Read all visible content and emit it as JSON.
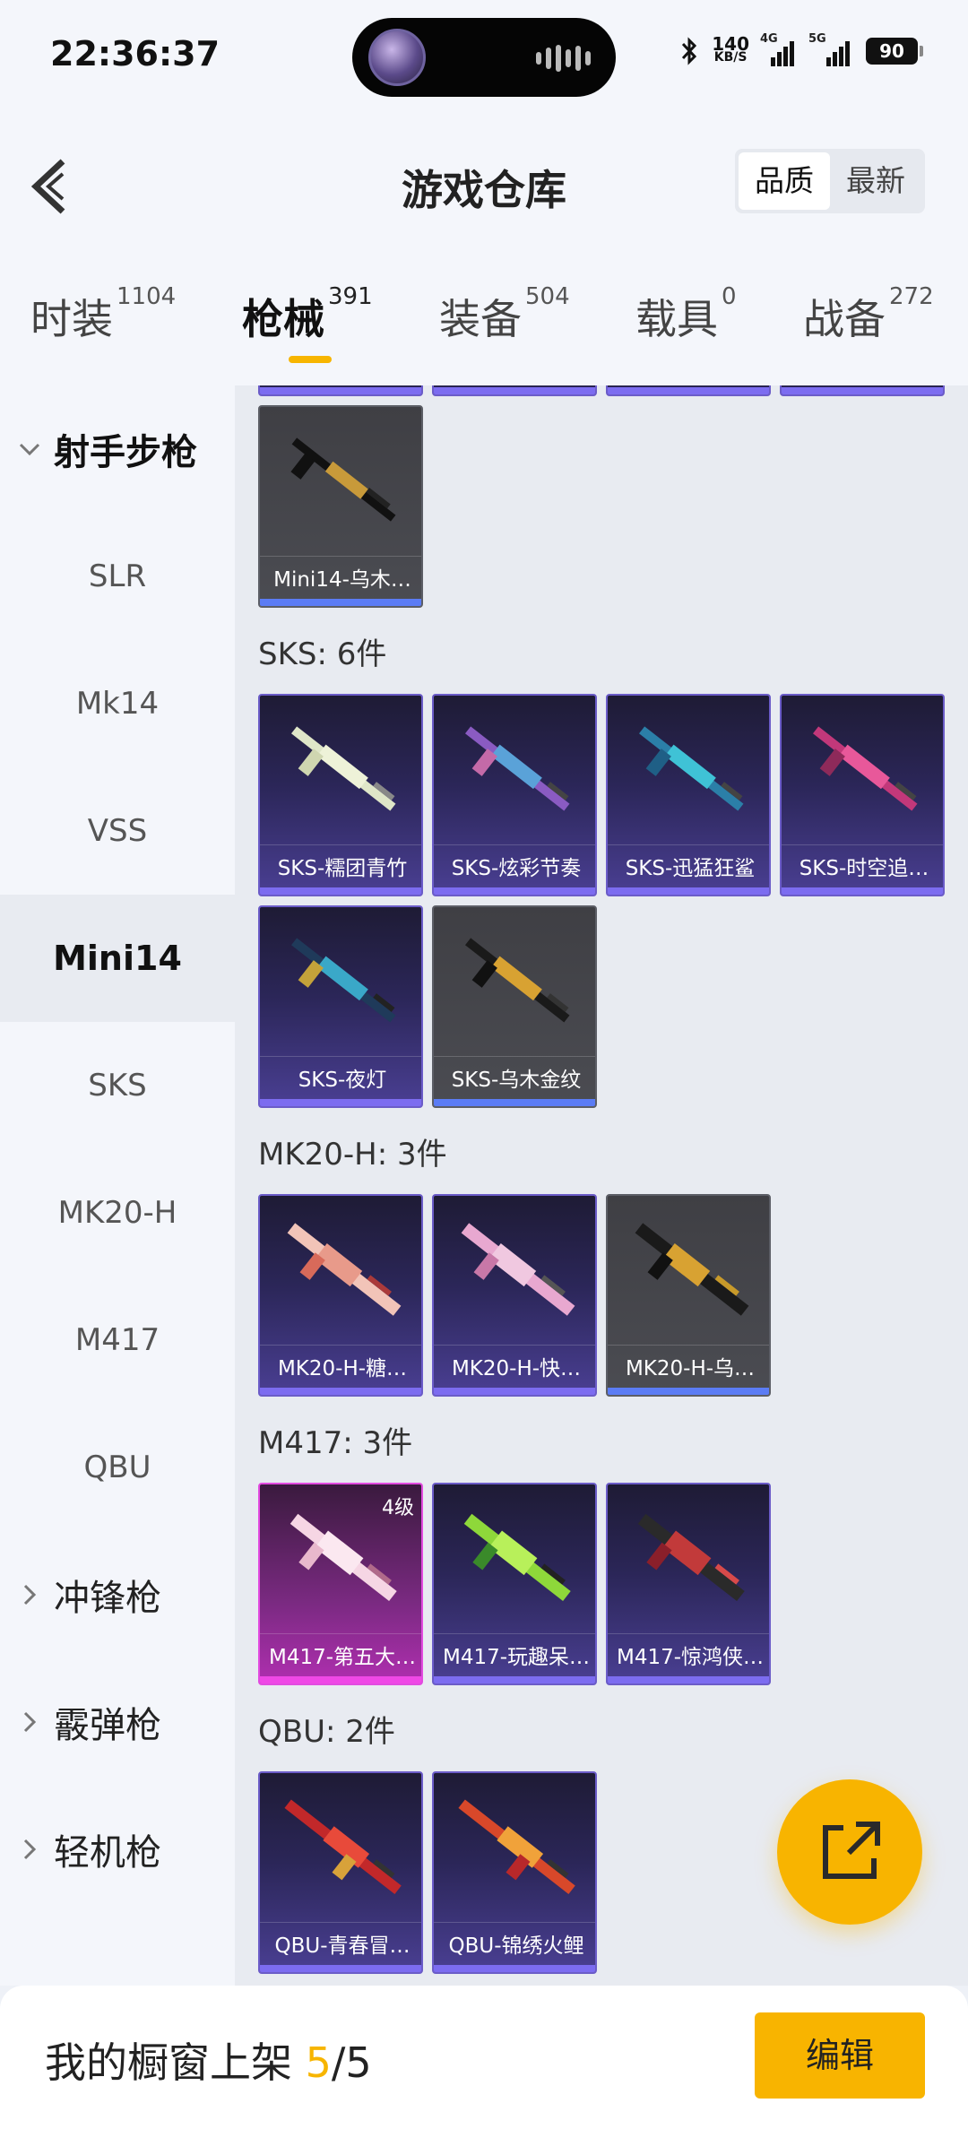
{
  "status_bar": {
    "time": "22:36:37",
    "net_speed": "140",
    "net_unit": "KB/S",
    "sig1_label": "4G",
    "sig2_label": "5G",
    "battery": "90"
  },
  "header": {
    "title": "游戏仓库",
    "sort_options": [
      "品质",
      "最新"
    ],
    "sort_active": "品质"
  },
  "tabs": [
    {
      "label": "时装",
      "count": "1104"
    },
    {
      "label": "枪械",
      "count": "391"
    },
    {
      "label": "装备",
      "count": "504"
    },
    {
      "label": "载具",
      "count": "0"
    },
    {
      "label": "战备",
      "count": "272"
    }
  ],
  "active_tab": "枪械",
  "sidebar": {
    "group_open": "射手步枪",
    "sub_items": [
      "SLR",
      "Mk14",
      "VSS",
      "Mini14",
      "SKS",
      "MK20-H",
      "M417",
      "QBU"
    ],
    "active_item": "Mini14",
    "groups_closed": [
      "冲锋枪",
      "霰弹枪",
      "轻机枪"
    ]
  },
  "sections": [
    {
      "title": "SKS: 6件"
    },
    {
      "title": "MK20-H: 3件"
    },
    {
      "title": "M417: 3件"
    },
    {
      "title": "QBU: 2件"
    }
  ],
  "items": {
    "mini14": [
      {
        "name": "Mini14-乌木…"
      }
    ],
    "sks": [
      {
        "name": "SKS-糯团青竹"
      },
      {
        "name": "SKS-炫彩节奏"
      },
      {
        "name": "SKS-迅猛狂鲨"
      },
      {
        "name": "SKS-时空追…"
      },
      {
        "name": "SKS-夜灯"
      },
      {
        "name": "SKS-乌木金纹"
      }
    ],
    "mk20": [
      {
        "name": "MK20-H-糖…"
      },
      {
        "name": "MK20-H-快…"
      },
      {
        "name": "MK20-H-乌…"
      }
    ],
    "m417": [
      {
        "name": "M417-第五大…",
        "level": "4级"
      },
      {
        "name": "M417-玩趣呆…"
      },
      {
        "name": "M417-惊鸿侠…"
      }
    ],
    "qbu": [
      {
        "name": "QBU-青春冒…"
      },
      {
        "name": "QBU-锦绣火鲤"
      }
    ]
  },
  "bottom": {
    "label": "我的橱窗上架",
    "current": "5",
    "separator": "/",
    "max": "5",
    "edit_label": "编辑"
  },
  "colors": {
    "accent": "#f8b400",
    "purple_quality": "#7c6cf0",
    "pink_quality": "#ef48e6",
    "grey_quality": "#5b7cf5"
  }
}
